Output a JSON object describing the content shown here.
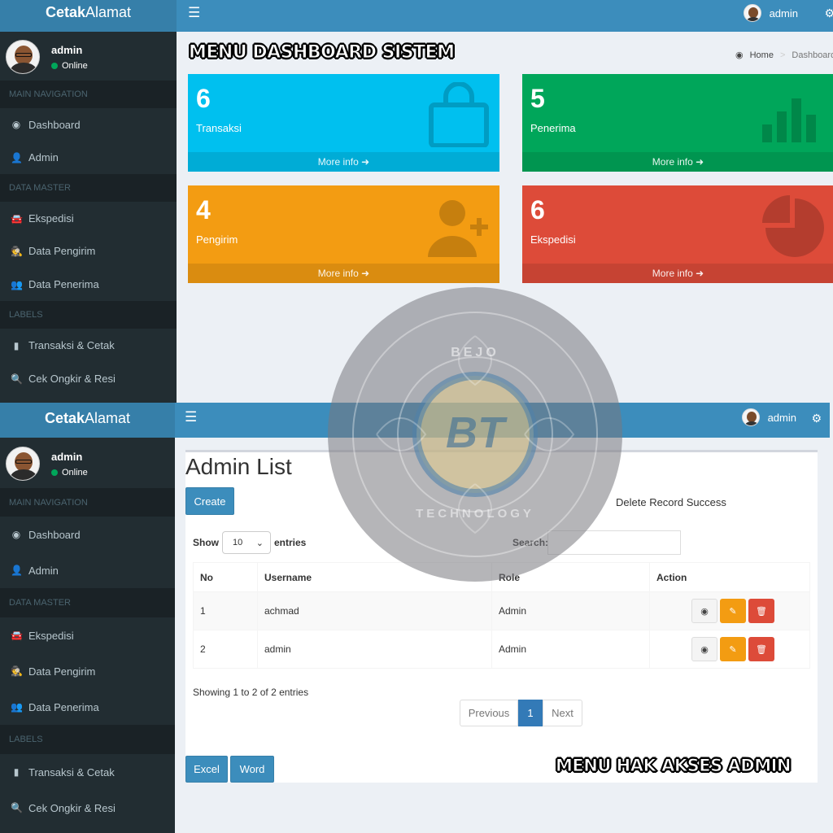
{
  "top": {
    "logo_bold": "Cetak",
    "logo_rest": "Alamat",
    "top_user": "admin",
    "user_name": "admin",
    "user_status": "Online",
    "nav": [
      {
        "type": "header",
        "label": "MAIN NAVIGATION"
      },
      {
        "type": "item",
        "label": "Dashboard",
        "icon": "dashboard-icon"
      },
      {
        "type": "item",
        "label": "Admin",
        "icon": "user-icon"
      },
      {
        "type": "header",
        "label": "DATA MASTER"
      },
      {
        "type": "item",
        "label": "Ekspedisi",
        "icon": "car-icon"
      },
      {
        "type": "item",
        "label": "Data Pengirim",
        "icon": "user-secret-icon"
      },
      {
        "type": "item",
        "label": "Data Penerima",
        "icon": "users-icon"
      },
      {
        "type": "header",
        "label": "LABELS"
      },
      {
        "type": "item",
        "label": "Transaksi & Cetak",
        "icon": "file-icon"
      },
      {
        "type": "item",
        "label": "Cek Ongkir & Resi",
        "icon": "search-icon"
      }
    ],
    "page_caption": "MENU DASHBOARD SISTEM",
    "breadcrumb": {
      "home": "Home",
      "sep": ">",
      "current": "Dashboard"
    },
    "boxes": [
      {
        "value": "6",
        "label": "Transaksi",
        "more": "More info",
        "color": "#00c0ef",
        "icon": "shopping-bag-icon"
      },
      {
        "value": "5",
        "label": "Penerima",
        "more": "More info",
        "color": "#00a65a",
        "icon": "bar-chart-icon"
      },
      {
        "value": "4",
        "label": "Pengirim",
        "more": "More info",
        "color": "#f39c12",
        "icon": "user-plus-icon"
      },
      {
        "value": "6",
        "label": "Ekspedisi",
        "more": "More info",
        "color": "#dd4b39",
        "icon": "pie-chart-icon"
      }
    ]
  },
  "bottom": {
    "logo_bold": "Cetak",
    "logo_rest": "Alamat",
    "top_user": "admin",
    "user_name": "admin",
    "user_status": "Online",
    "nav": [
      {
        "type": "header",
        "label": "MAIN NAVIGATION"
      },
      {
        "type": "item",
        "label": "Dashboard",
        "icon": "dashboard-icon"
      },
      {
        "type": "item",
        "label": "Admin",
        "icon": "user-icon"
      },
      {
        "type": "header",
        "label": "DATA MASTER"
      },
      {
        "type": "item",
        "label": "Ekspedisi",
        "icon": "car-icon"
      },
      {
        "type": "item",
        "label": "Data Pengirim",
        "icon": "user-secret-icon"
      },
      {
        "type": "item",
        "label": "Data Penerima",
        "icon": "users-icon"
      },
      {
        "type": "header",
        "label": "LABELS"
      },
      {
        "type": "item",
        "label": "Transaksi & Cetak",
        "icon": "file-icon"
      },
      {
        "type": "item",
        "label": "Cek Ongkir & Resi",
        "icon": "search-icon"
      }
    ],
    "panel_title": "Admin List",
    "create_label": "Create",
    "message": "Delete Record Success",
    "show_label": "Show",
    "show_value": "10",
    "entries_label": "entries",
    "search_label": "Search:",
    "columns": [
      "No",
      "Username",
      "Role",
      "Action"
    ],
    "rows": [
      {
        "no": "1",
        "username": "achmad",
        "role": "Admin"
      },
      {
        "no": "2",
        "username": "admin",
        "role": "Admin"
      }
    ],
    "info": "Showing 1 to 2 of 2 entries",
    "pager": {
      "prev": "Previous",
      "current": "1",
      "next": "Next"
    },
    "excel_label": "Excel",
    "word_label": "Word",
    "caption": "MENU HAK AKSES ADMIN"
  },
  "watermark": {
    "top_text": "BEJO",
    "mono": "BT",
    "bottom_text": "TECHNOLOGY"
  },
  "colors": {
    "primary": "#3c8dbc",
    "sidebar": "#222d32",
    "aqua": "#00c0ef",
    "green": "#00a65a",
    "yellow": "#f39c12",
    "red": "#dd4b39"
  }
}
